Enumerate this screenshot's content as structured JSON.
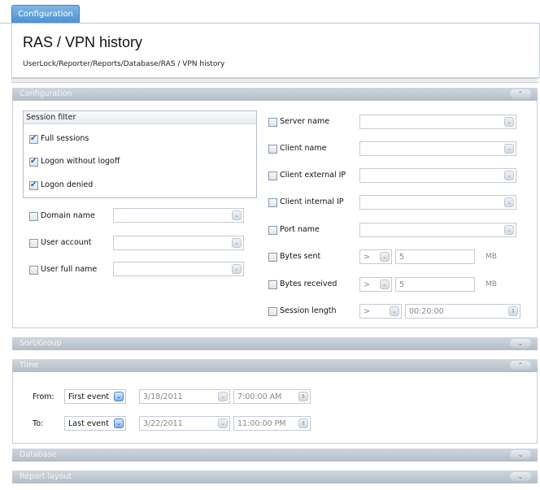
{
  "tab": {
    "label": "Configuration"
  },
  "header": {
    "title": "RAS / VPN history",
    "breadcrumb": "UserLock/Reporter/Reports/Database/RAS / VPN history"
  },
  "sections": {
    "configuration": "Configuration",
    "sort_group": "Sort/Group",
    "time": "Time",
    "database": "Database",
    "report_layout": "Report layout"
  },
  "session_filter": {
    "title": "Session filter",
    "items": [
      {
        "label": "Full sessions",
        "checked": true
      },
      {
        "label": "Logon without logoff",
        "checked": true
      },
      {
        "label": "Logon denied",
        "checked": true
      }
    ]
  },
  "left_filters": [
    {
      "label": "Domain name",
      "checked": false
    },
    {
      "label": "User account",
      "checked": false
    },
    {
      "label": "User full name",
      "checked": false
    }
  ],
  "right_filters": [
    {
      "label": "Server name",
      "checked": false
    },
    {
      "label": "Client name",
      "checked": false
    },
    {
      "label": "Client external IP",
      "checked": false
    },
    {
      "label": "Client internal IP",
      "checked": false
    },
    {
      "label": "Port name",
      "checked": false
    }
  ],
  "numeric_filters": {
    "bytes_sent": {
      "label": "Bytes sent",
      "operator": ">",
      "value": "5",
      "unit": "MB"
    },
    "bytes_received": {
      "label": "Bytes received",
      "operator": ">",
      "value": "5",
      "unit": "MB"
    },
    "session_length": {
      "label": "Session length",
      "operator": ">",
      "value": "00:20:00"
    }
  },
  "time": {
    "from": {
      "label": "From:",
      "mode": "First event",
      "date": "3/18/2011",
      "time": "7:00:00 AM"
    },
    "to": {
      "label": "To:",
      "mode": "Last event",
      "date": "3/22/2011",
      "time": "11:00:00 PM"
    }
  },
  "icons": {
    "dropdown": "chevron-down-icon",
    "collapse": "chevron-up-icon",
    "expand": "chevron-down-icon"
  },
  "colors": {
    "tab": "#4b8fcf",
    "section_header": "#b3bdc7"
  }
}
